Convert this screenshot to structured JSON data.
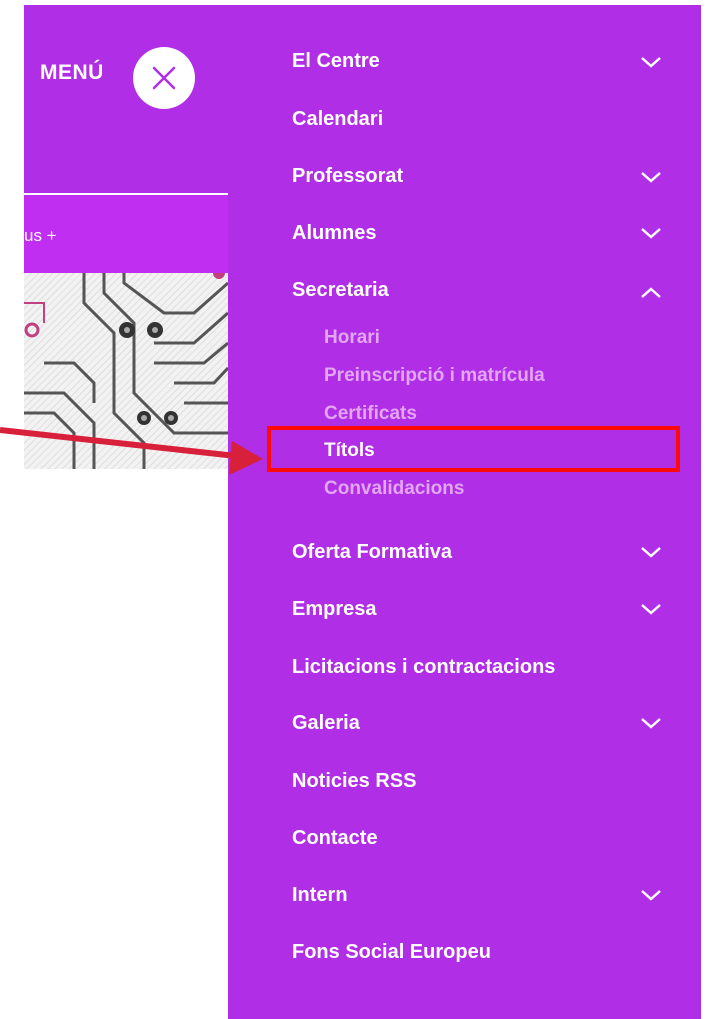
{
  "header": {
    "menu_label": "MENÚ"
  },
  "promo": {
    "text": "us +"
  },
  "nav": {
    "items": [
      {
        "label": "El Centre",
        "icon": "chevron-down-icon"
      },
      {
        "label": "Calendari"
      },
      {
        "label": "Professorat",
        "icon": "chevron-down-icon"
      },
      {
        "label": "Alumnes",
        "icon": "chevron-down-icon"
      },
      {
        "label": "Secretaria",
        "icon": "chevron-up-icon"
      },
      {
        "label": "Oferta Formativa",
        "icon": "chevron-down-icon"
      },
      {
        "label": "Empresa",
        "icon": "chevron-down-icon"
      },
      {
        "label": "Licitacions i contractacions"
      },
      {
        "label": "Galeria",
        "icon": "chevron-down-icon"
      },
      {
        "label": "Noticies RSS"
      },
      {
        "label": "Contacte"
      },
      {
        "label": "Intern",
        "icon": "chevron-down-icon"
      },
      {
        "label": "Fons Social Europeu"
      }
    ],
    "secretaria_sub": [
      {
        "label": "Horari"
      },
      {
        "label": "Preinscripció i matrícula"
      },
      {
        "label": "Certificats"
      },
      {
        "label": "Títols"
      },
      {
        "label": "Convalidacions"
      }
    ]
  },
  "colors": {
    "panel": "#b02ee6",
    "promo": "#c02ef2",
    "highlight": "#ff0a0a",
    "arrow": "#d9203a",
    "submenu_text": "#e2a6f2"
  }
}
